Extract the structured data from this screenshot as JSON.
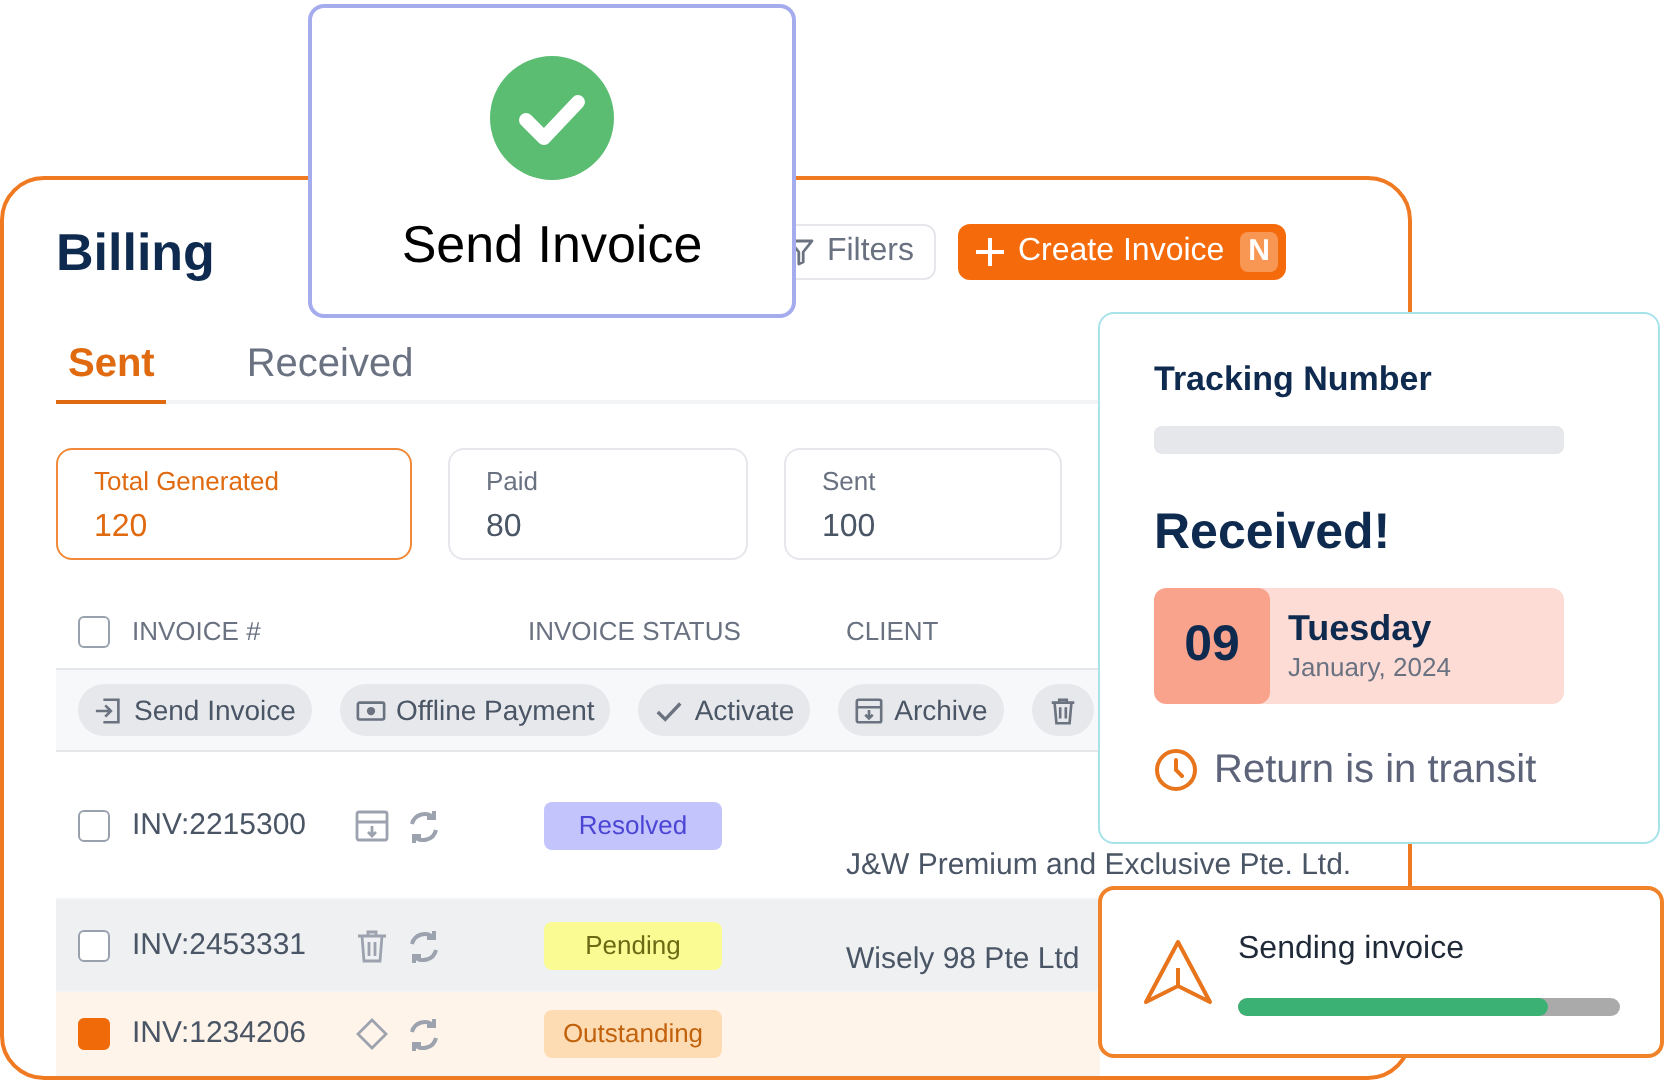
{
  "billing": {
    "title": "Billing",
    "filter_button": "Filters",
    "create_button": {
      "label": "Create Invoice",
      "shortcut": "N"
    },
    "tabs": [
      {
        "label": "Sent",
        "selected": true
      },
      {
        "label": "Received",
        "selected": false
      }
    ],
    "stats": [
      {
        "label": "Total Generated",
        "value": "120",
        "selected": true
      },
      {
        "label": "Paid",
        "value": "80",
        "selected": false
      },
      {
        "label": "Sent",
        "value": "100",
        "selected": false
      }
    ],
    "table": {
      "select_all_checked": false,
      "columns": [
        "INVOICE #",
        "INVOICE STATUS",
        "CLIENT"
      ],
      "bulk_actions": [
        {
          "kind": "send",
          "label": "Send Invoice"
        },
        {
          "kind": "payment",
          "label": "Offline Payment"
        },
        {
          "kind": "activate",
          "label": "Activate"
        },
        {
          "kind": "archive",
          "label": "Archive"
        },
        {
          "kind": "delete"
        }
      ],
      "rows": [
        {
          "checked": false,
          "highlighted": false,
          "invoice": "INV:2215300",
          "actions": [
            {
              "kind": "archive"
            },
            {
              "kind": "refresh"
            }
          ],
          "status": {
            "kind": "resolved",
            "label": "Resolved"
          },
          "client": "J&W Premium and Exclusive Pte. Ltd."
        },
        {
          "checked": false,
          "highlighted": true,
          "invoice": "INV:2453331",
          "actions": [
            {
              "kind": "trash"
            },
            {
              "kind": "refresh"
            }
          ],
          "status": {
            "kind": "pending",
            "label": "Pending"
          },
          "client": "Wisely 98 Pte Ltd"
        },
        {
          "checked": true,
          "highlighted": false,
          "invoice": "INV:1234206",
          "actions": [
            {
              "kind": "tag"
            },
            {
              "kind": "refresh"
            }
          ],
          "status": {
            "kind": "outstanding",
            "label": "Outstanding"
          }
        }
      ]
    }
  },
  "send_popup": {
    "title": "Send Invoice"
  },
  "tracking": {
    "title": "Tracking Number",
    "heading": "Received!",
    "day": "09",
    "weekday": "Tuesday",
    "month_year": "January, 2024",
    "note": "Return is in transit"
  },
  "progress_toast": {
    "title": "Sending invoice",
    "level": 0.81
  }
}
